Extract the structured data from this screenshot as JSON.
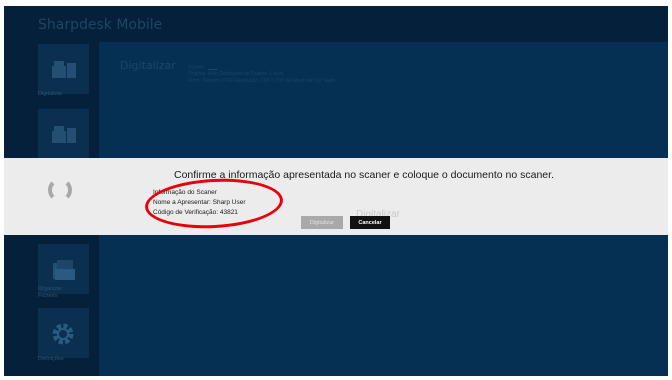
{
  "app": {
    "title": "Sharpdesk Mobile"
  },
  "sidebar": {
    "items": [
      {
        "label": "Digitalizar",
        "icon": "scanner-icon"
      },
      {
        "label": "",
        "icon": "scanner-icon"
      },
      {
        "label": "Organizar\nFicheiro",
        "icon": "folder-icon"
      },
      {
        "label": "Definições",
        "icon": "gear-icon"
      }
    ]
  },
  "main": {
    "heading": "Digitalizar",
    "scanner_label": "Scaner",
    "line1": "Original: Auto   Definições de Duplex: 1-face",
    "line2": "Form. Ficheiro: PDF   Resolução: 200 X 200 dpi   Modo de Cor: Auto"
  },
  "dialog": {
    "message": "Confirme a informação apresentada no scaner e coloque o documento no scaner.",
    "info_title": "Informação do Scaner",
    "display_name": "Nome a Apresentar: Sharp User",
    "verification_code": "Código de Verificação: 43821",
    "scan_button": "Digitalizar",
    "cancel_button": "Cancelar",
    "ghost_text": "Digitalizar"
  },
  "colors": {
    "app_bg": "#04203a",
    "content_bg": "#063053",
    "overlay_bg": "#ececec",
    "highlight": "#e8000d"
  }
}
